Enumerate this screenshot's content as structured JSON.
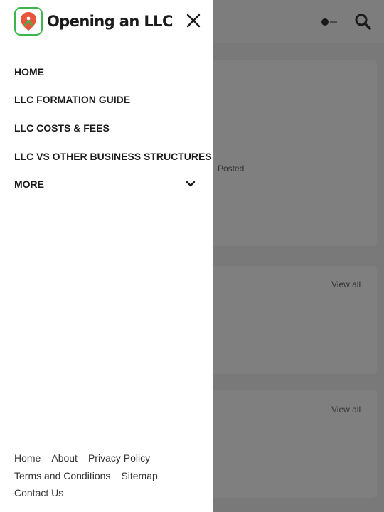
{
  "brand": {
    "name": "Opening an LLC",
    "logo_icon": "location-pin-logo-icon",
    "accent": "#3cb54a",
    "accent_secondary": "#e8553d"
  },
  "header_icons": {
    "theme_toggle": "theme-toggle-icon",
    "search": "search-icon",
    "close": "close-icon"
  },
  "nav": {
    "items": [
      {
        "label": "HOME"
      },
      {
        "label": "LLC FORMATION GUIDE"
      },
      {
        "label": "LLC COSTS & FEES"
      },
      {
        "label": "LLC VS OTHER BUSINESS STRUCTURES"
      },
      {
        "label": "MORE",
        "icon": "chevron-down-icon"
      }
    ]
  },
  "footer": {
    "links": [
      [
        "Home",
        "About",
        "Privacy Policy"
      ],
      [
        "Terms and Conditions",
        "Sitemap"
      ],
      [
        "Contact Us"
      ]
    ]
  },
  "background": {
    "snippet": "Posted",
    "view_all_1": "View all",
    "view_all_2": "View all"
  }
}
